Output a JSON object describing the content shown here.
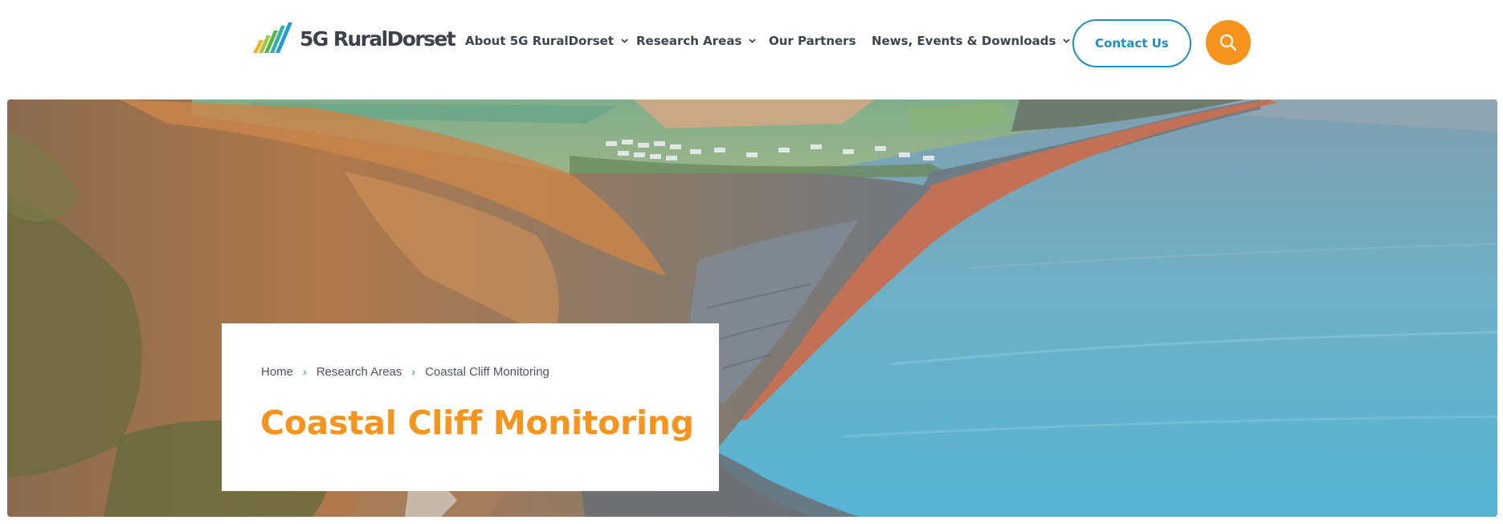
{
  "brand": {
    "name": "5G RuralDorset",
    "colors": {
      "orange": "#f7941d",
      "blue": "#1e8fc6",
      "dark_text": "#3c4650"
    }
  },
  "nav": {
    "items": [
      {
        "label": "About 5G RuralDorset",
        "has_dropdown": true
      },
      {
        "label": "Research Areas",
        "has_dropdown": true
      },
      {
        "label": "Our Partners",
        "has_dropdown": false
      },
      {
        "label": "News, Events & Downloads",
        "has_dropdown": true
      }
    ],
    "contact_label": "Contact Us",
    "search_icon": "search-icon"
  },
  "breadcrumb": {
    "items": [
      "Home",
      "Research Areas",
      "Coastal Cliff Monitoring"
    ],
    "separator_icon": "chevron-right-icon"
  },
  "page": {
    "title": "Coastal Cliff Monitoring"
  }
}
